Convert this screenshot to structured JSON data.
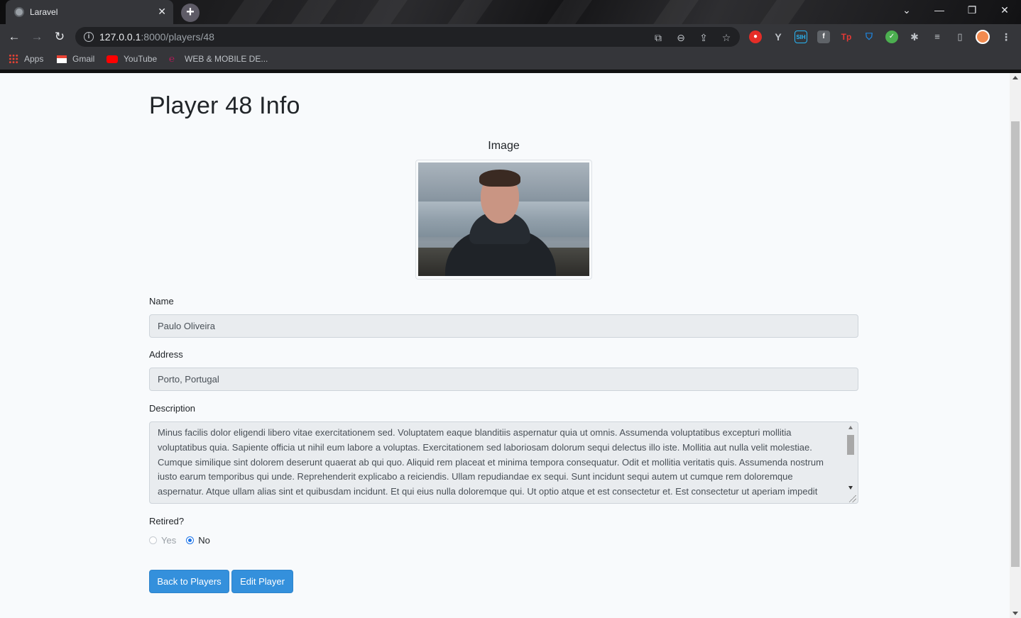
{
  "browser": {
    "tab_title": "Laravel",
    "url_host": "127.0.0.1",
    "url_rest": ":8000/players/48",
    "bookmarks": [
      {
        "label": "Apps",
        "icon": "apps-grid-icon"
      },
      {
        "label": "Gmail",
        "icon": "gmail-icon"
      },
      {
        "label": "YouTube",
        "icon": "youtube-icon"
      },
      {
        "label": "WEB & MOBILE DE...",
        "icon": "bookmark-site-icon"
      }
    ]
  },
  "page": {
    "title": "Player 48 Info",
    "image_label": "Image",
    "name_label": "Name",
    "name_value": "Paulo Oliveira",
    "address_label": "Address",
    "address_value": "Porto, Portugal",
    "description_label": "Description",
    "description_value": "Minus facilis dolor eligendi libero vitae exercitationem sed. Voluptatem eaque blanditiis aspernatur quia ut omnis. Assumenda voluptatibus excepturi mollitia voluptatibus quia. Sapiente officia ut nihil eum labore a voluptas. Exercitationem sed laboriosam dolorum sequi delectus illo iste. Mollitia aut nulla velit molestiae. Cumque similique sint dolorem deserunt quaerat ab qui quo. Aliquid rem placeat et minima tempora consequatur. Odit et mollitia veritatis quis. Assumenda nostrum iusto earum temporibus qui unde. Reprehenderit explicabo a reiciendis. Ullam repudiandae ex sequi. Sunt incidunt sequi autem ut cumque rem doloremque aspernatur. Atque ullam alias sint et quibusdam incidunt. Et qui eius nulla doloremque qui. Ut optio atque et est consectetur et. Est consectetur ut aperiam impedit",
    "retired_label": "Retired?",
    "retired_yes": "Yes",
    "retired_no": "No",
    "retired_selected": "No",
    "back_button": "Back to Players",
    "edit_button": "Edit Player"
  },
  "colors": {
    "primary_button": "#3490dc",
    "field_bg": "#e9ecef",
    "page_bg": "#f8fafc"
  }
}
